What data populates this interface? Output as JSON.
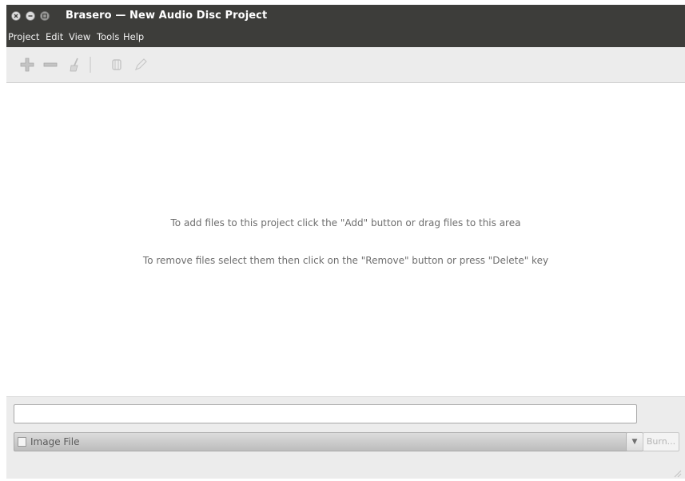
{
  "window": {
    "title": "Brasero — New Audio Disc Project",
    "buttons": [
      "close-icon",
      "minimize-icon",
      "maximize-icon"
    ]
  },
  "menubar": {
    "items": [
      "Project",
      "Edit",
      "View",
      "Tools",
      "Help"
    ]
  },
  "toolbar": {
    "icons": [
      "add-icon",
      "remove-icon",
      "clean-icon",
      "split-icon",
      "edit-icon"
    ]
  },
  "content": {
    "hint_add": "To add files to this project click the \"Add\" button or drag files to this area",
    "hint_remove": "To remove files select them then click on the \"Remove\" button or press \"Delete\" key"
  },
  "bottom": {
    "disc_name_value": "",
    "target_label": "Image File",
    "burn_label": "Burn..."
  },
  "colors": {
    "titlebar": "#3d3d3a",
    "toolbar": "#ececec",
    "hint_text": "#6e6e6e"
  }
}
